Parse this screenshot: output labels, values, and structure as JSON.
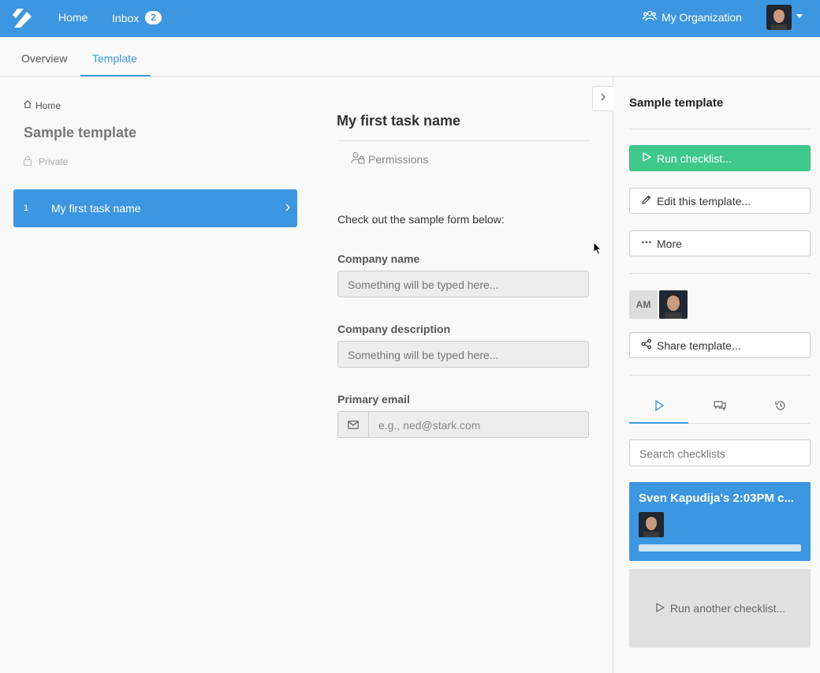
{
  "topbar": {
    "nav_home": "Home",
    "nav_inbox": "Inbox",
    "inbox_count": "2",
    "organization": "My Organization",
    "accent": "#3d96e0"
  },
  "tabs": {
    "overview": "Overview",
    "template": "Template",
    "active": "Template"
  },
  "left": {
    "breadcrumb": "Home",
    "title": "Sample template",
    "visibility": "Private",
    "tasks": [
      {
        "number": "1",
        "label": "My first task name"
      }
    ]
  },
  "task": {
    "title": "My first task name",
    "permissions": "Permissions",
    "intro": "Check out the sample form below:",
    "fields": [
      {
        "label": "Company name",
        "placeholder": "Something will be typed here..."
      },
      {
        "label": "Company description",
        "placeholder": "Something will be typed here..."
      },
      {
        "label": "Primary email",
        "placeholder": "e.g., ned@stark.com"
      }
    ]
  },
  "panel": {
    "title": "Sample template",
    "run_button": "Run checklist...",
    "edit_button": "Edit this template...",
    "more_button": "More",
    "avatar_initials": "AM",
    "share_button": "Share template...",
    "search_placeholder": "Search checklists",
    "checklist": {
      "title": "Sven Kapudija's 2:03PM c...",
      "progress": 0
    },
    "run_another": "Run another checklist...",
    "run_color": "#3ec98a"
  }
}
